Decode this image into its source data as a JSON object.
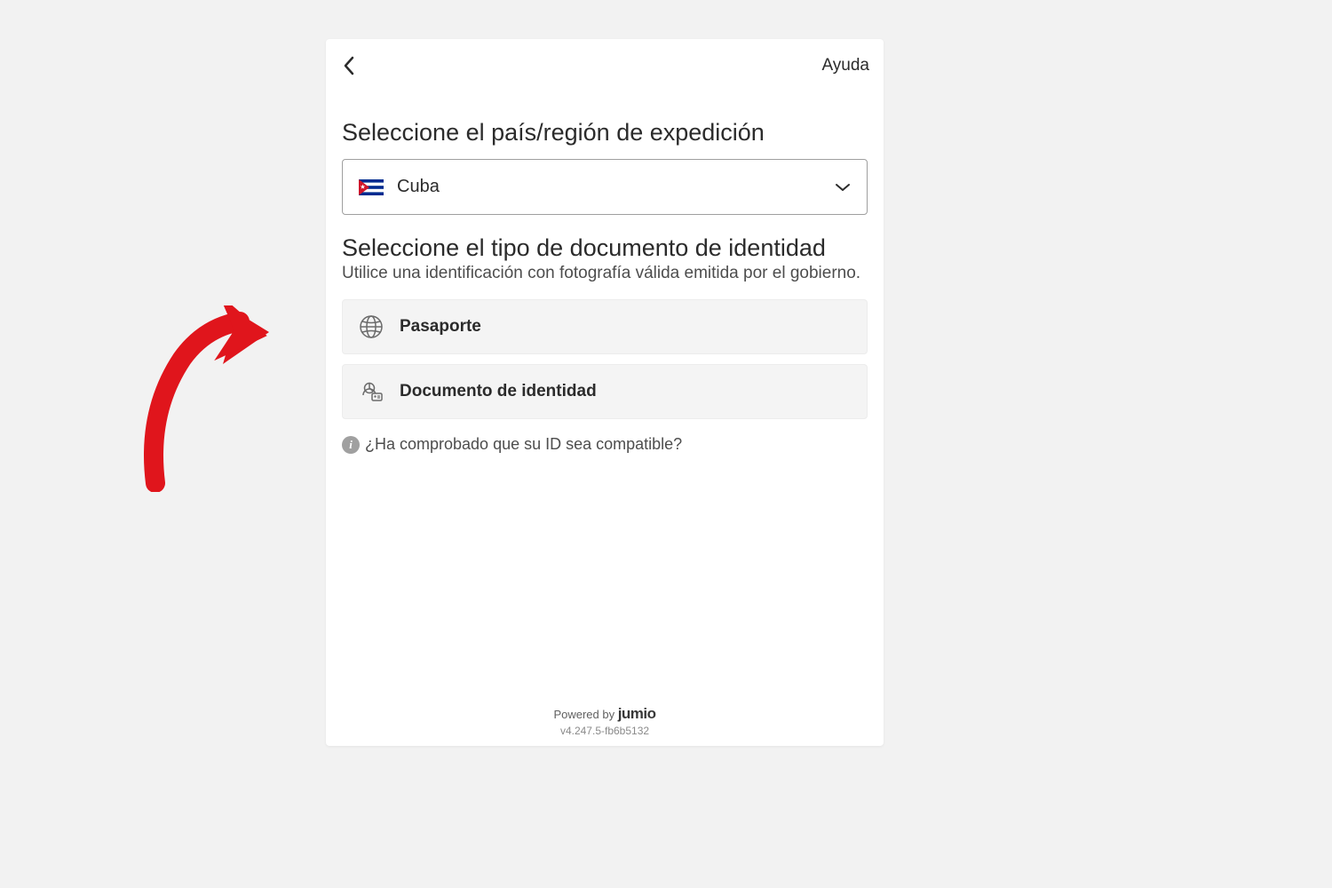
{
  "header": {
    "help_label": "Ayuda"
  },
  "country_section": {
    "title": "Seleccione el país/región de expedición",
    "selected": "Cuba"
  },
  "document_section": {
    "title": "Seleccione el tipo de documento de identidad",
    "subtitle": "Utilice una identificación con fotografía válida emitida por el gobierno.",
    "options": [
      {
        "label": "Pasaporte"
      },
      {
        "label": "Documento de identidad"
      }
    ]
  },
  "info": {
    "text": "¿Ha comprobado que su ID sea compatible?"
  },
  "footer": {
    "powered_by": "Powered by ",
    "brand": "jumio",
    "version": "v4.247.5-fb6b5132"
  }
}
